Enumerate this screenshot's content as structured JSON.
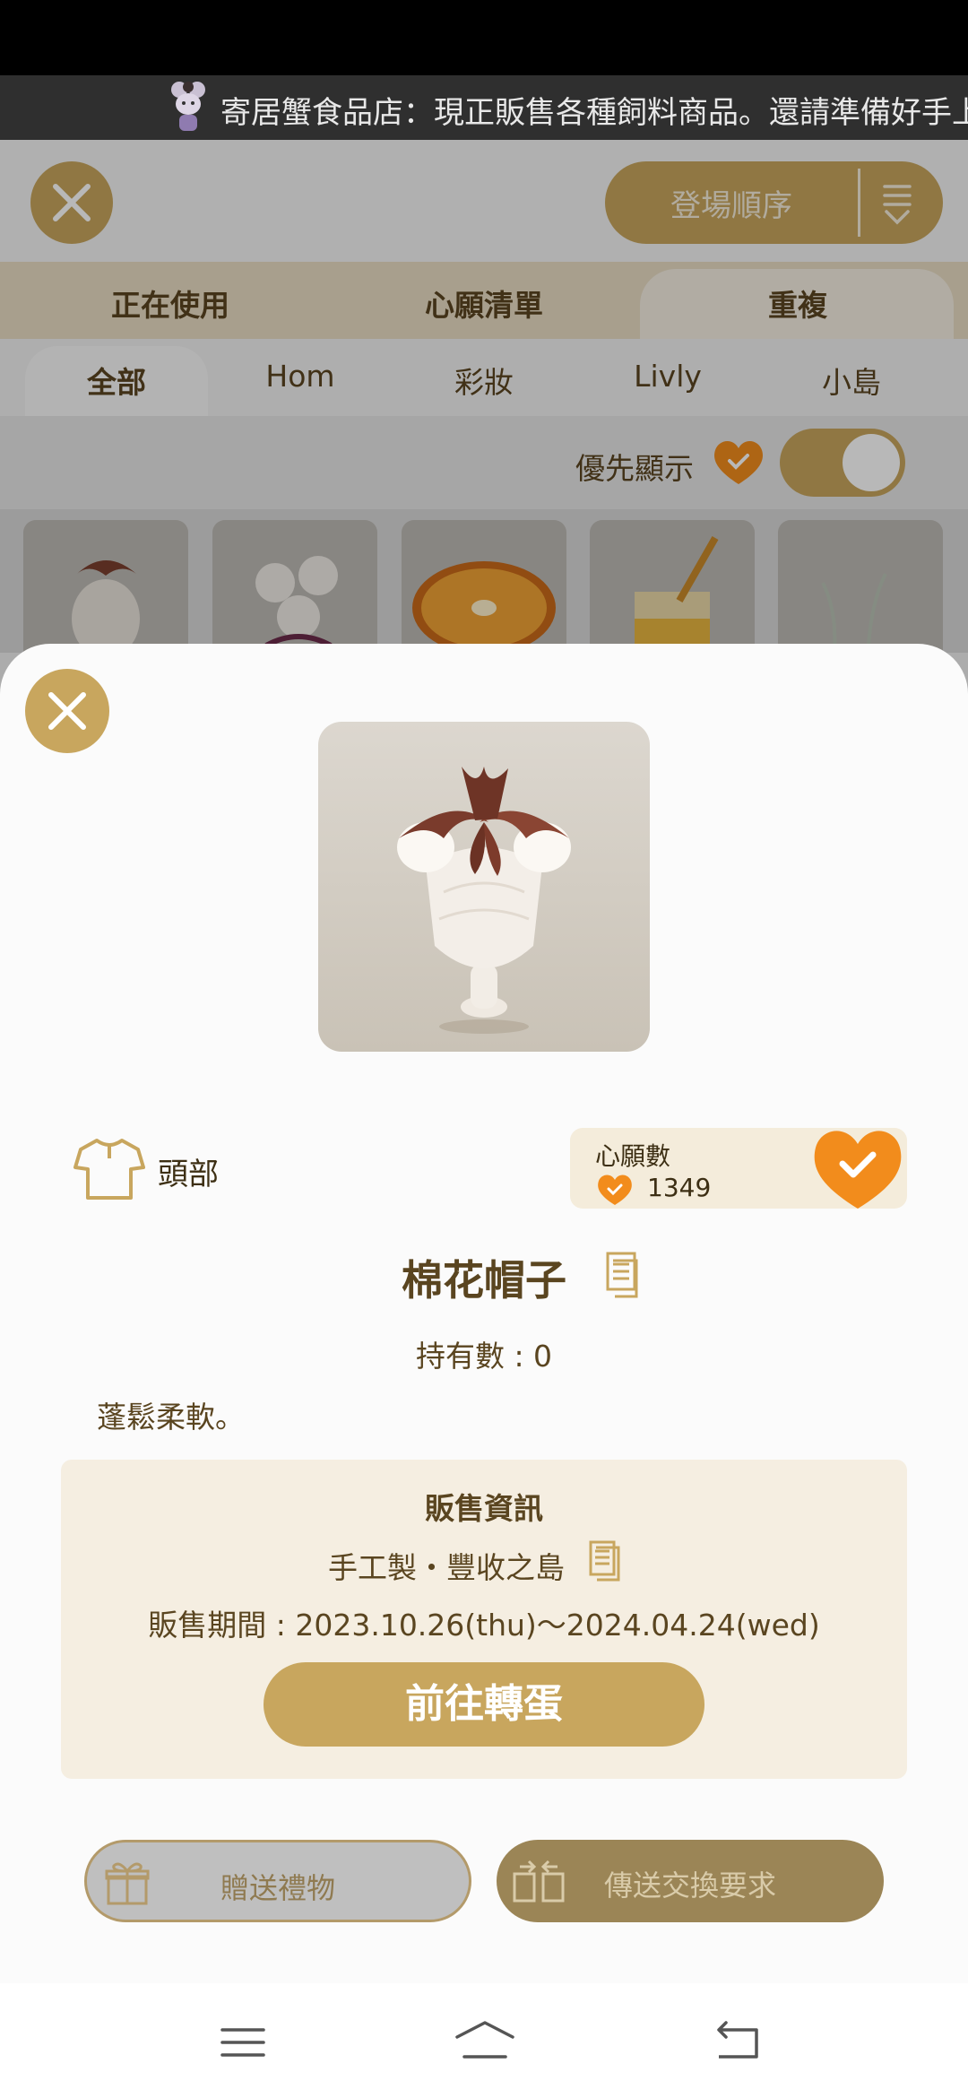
{
  "ticker": {
    "text": "寄居蟹食品店：現正販售各種飼料商品。還請準備好手上"
  },
  "toolbar": {
    "sort_label": "登場順序"
  },
  "tabs_primary": [
    {
      "label": "正在使用"
    },
    {
      "label": "心願清單"
    },
    {
      "label": "重複"
    }
  ],
  "tabs_secondary": [
    {
      "label": "全部"
    },
    {
      "label": "Hom"
    },
    {
      "label": "彩妝"
    },
    {
      "label": "Livly"
    },
    {
      "label": "小島"
    }
  ],
  "preference": {
    "label": "優先顯示",
    "toggle_on": true
  },
  "item": {
    "category": "頭部",
    "wish_title": "心願數",
    "wish_count": "1349",
    "name": "棉花帽子",
    "owned": "持有數 : 0",
    "description": "蓬鬆柔軟。"
  },
  "sale": {
    "title": "販售資訊",
    "source": "手工製・豐收之島",
    "period": "販售期間 : 2023.10.26(thu)〜2024.04.24(wed)",
    "go_button": "前往轉蛋"
  },
  "actions": {
    "gift": "贈送禮物",
    "trade": "傳送交換要求"
  },
  "colors": {
    "accent": "#c8a65e",
    "heart": "#f28c1c",
    "text": "#5a4520"
  }
}
